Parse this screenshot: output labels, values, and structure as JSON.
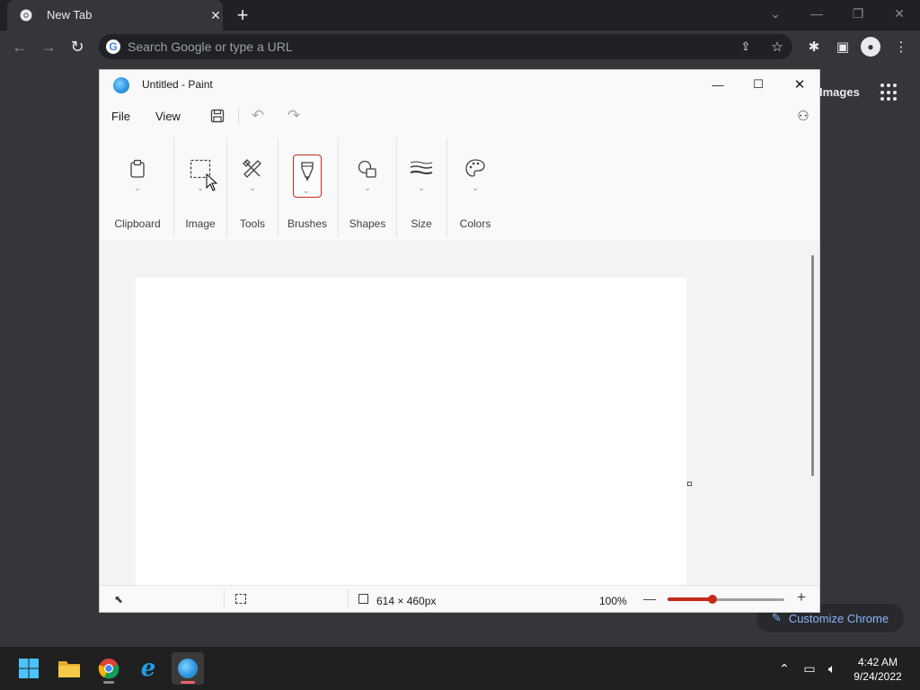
{
  "browser": {
    "tab_title": "New Tab",
    "tab_close": "✕",
    "new_tab": "+",
    "omnibox_placeholder": "Search Google or type a URL",
    "images_link": "Images",
    "customize_label": "Customize Chrome"
  },
  "paint": {
    "title": "Untitled - Paint",
    "menu": {
      "file": "File",
      "view": "View"
    },
    "groups": {
      "clipboard": "Clipboard",
      "image": "Image",
      "tools": "Tools",
      "brushes": "Brushes",
      "shapes": "Shapes",
      "size": "Size",
      "colors": "Colors"
    },
    "status": {
      "dimensions": "614 × 460px",
      "zoom": "100%",
      "zoom_level_percent": 100
    }
  },
  "taskbar": {
    "time": "4:42 AM",
    "date": "9/24/2022"
  },
  "colors": {
    "accent": "#c42b1c",
    "chrome_dark": "#202124",
    "link_blue": "#8ab4f8"
  }
}
